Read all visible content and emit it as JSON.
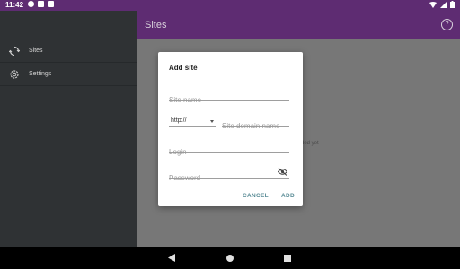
{
  "status_bar": {
    "time": "11:42"
  },
  "drawer": {
    "items": [
      {
        "label": "Sites",
        "icon": "sync-icon"
      },
      {
        "label": "Settings",
        "icon": "gear-icon"
      }
    ]
  },
  "app_bar": {
    "title": "Sites",
    "help_glyph": "?"
  },
  "main": {
    "empty_text": "ded yet"
  },
  "dialog": {
    "title": "Add site",
    "site_name_placeholder": "Site name",
    "protocol_value": "http://",
    "domain_placeholder": "Site domain name",
    "login_placeholder": "Login",
    "password_placeholder": "Password",
    "cancel_label": "CANCEL",
    "add_label": "ADD"
  },
  "colors": {
    "primary": "#5e2c72",
    "accent": "#5a8c96",
    "drawer_bg": "#2f3234",
    "scrim": "#777777"
  }
}
